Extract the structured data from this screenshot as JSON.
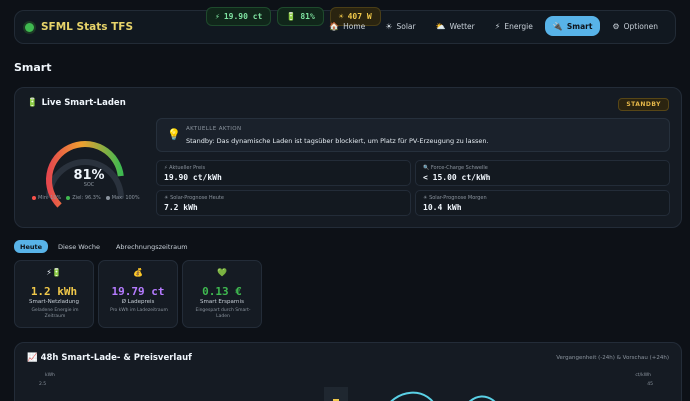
{
  "header": {
    "brand": "SFML Stats TFS",
    "pills": {
      "price": "19.90 ct",
      "soc": "81%",
      "power": "407 W"
    },
    "pill_icons": {
      "price": "⚡",
      "soc": "🔋",
      "power": "☀"
    },
    "nav": [
      {
        "label": "Home",
        "icon": "🏠"
      },
      {
        "label": "Solar",
        "icon": "☀"
      },
      {
        "label": "Wetter",
        "icon": "⛅"
      },
      {
        "label": "Energie",
        "icon": "⚡"
      },
      {
        "label": "Smart",
        "icon": "🔌"
      },
      {
        "label": "Optionen",
        "icon": "⚙"
      }
    ]
  },
  "page_title": "Smart",
  "live": {
    "title": "Live Smart-Laden",
    "title_icon": "🔋",
    "badge": "STANDBY",
    "gauge": {
      "value": "81%",
      "label": "SOC",
      "fraction": 0.81
    },
    "legend": {
      "min": "Min: 10%",
      "target": "Ziel: 96.3%",
      "max": "Max: 100%"
    },
    "legend_colors": {
      "min": "#f85149",
      "target": "#3fb950",
      "max": "#8b949e"
    },
    "action": {
      "kicker": "AKTUELLE AKTION",
      "text": "Standby: Das dynamische Laden ist tagsüber blockiert, um Platz für PV-Erzeugung zu lassen."
    },
    "stats": [
      {
        "label": "⚡ Aktueller Preis",
        "value": "19.90 ct/kWh"
      },
      {
        "label": "🔍 Force-Charge Schwelle",
        "value": "< 15.00 ct/kWh"
      },
      {
        "label": "☀ Solar-Prognose Heute",
        "value": "7.2 kWh"
      },
      {
        "label": "☀ Solar-Prognose Morgen",
        "value": "10.4 kWh"
      }
    ]
  },
  "tabs": [
    "Heute",
    "Diese Woche",
    "Abrechnungszeitraum"
  ],
  "summary": [
    {
      "icon": "⚡🔋",
      "value": "1.2 kWh",
      "label": "Smart-Netzladung",
      "sub": "Geladene Energie im Zeitraum",
      "color": "#f0c84a"
    },
    {
      "icon": "💰",
      "value": "19.79 ct",
      "label": "Ø Ladepreis",
      "sub": "Pro kWh im Ladezeitraum",
      "color": "#b57bff"
    },
    {
      "icon": "💚",
      "value": "0.13 €",
      "label": "Smart Ersparnis",
      "sub": "Eingespart durch Smart-Laden",
      "color": "#3fb950"
    }
  ],
  "chart": {
    "title": "48h Smart-Lade- & Preisverlauf",
    "title_icon": "📈",
    "note": "Vergangenheit (-24h) & Vorschau (+24h)",
    "left_unit": "kWh",
    "right_unit": "ct/kWh",
    "left_tick": "2.5",
    "right_tick": "45"
  }
}
